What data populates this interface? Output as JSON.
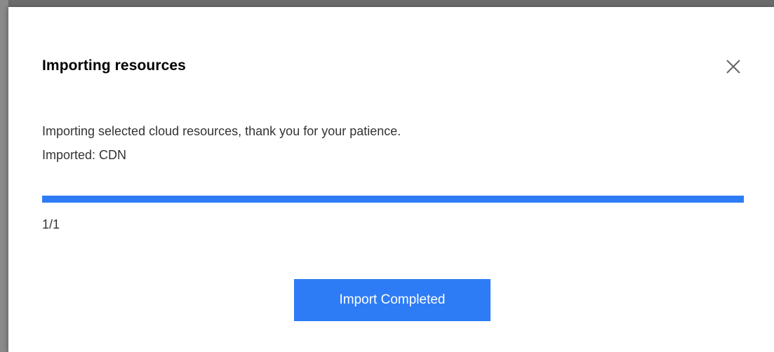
{
  "dialog": {
    "title": "Importing resources",
    "close_icon": "close-icon",
    "message": "Importing selected cloud resources, thank you for your patience.",
    "imported": "Imported: CDN",
    "progress": {
      "completed": 1,
      "total": 1,
      "fraction": 1.0,
      "label": "1/1"
    },
    "primary_button": "Import Completed"
  },
  "colors": {
    "accent": "#2d7cf5",
    "track": "#e5e5e5",
    "text": "#333333"
  }
}
